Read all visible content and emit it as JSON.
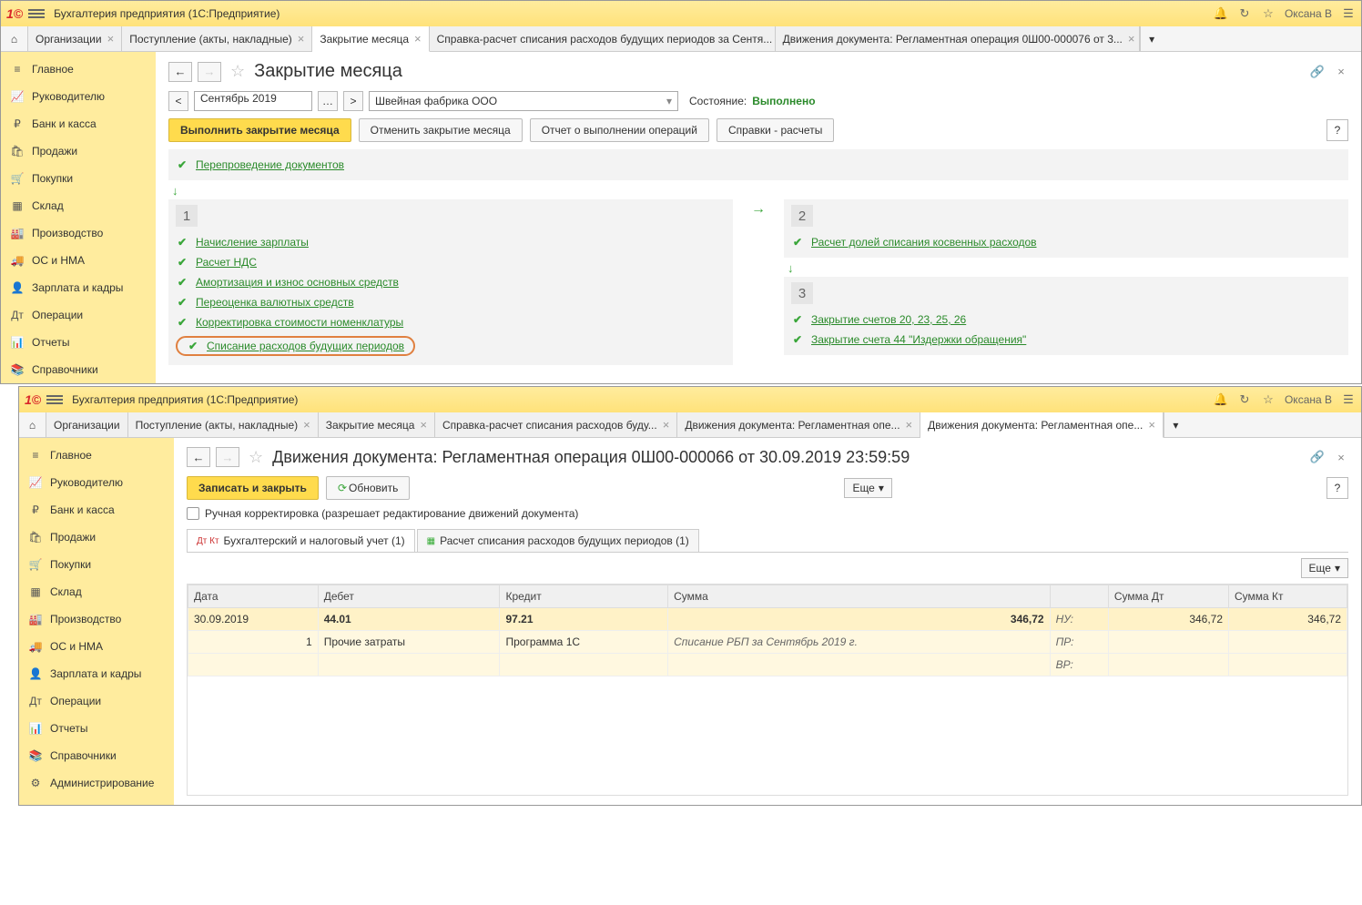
{
  "app_title": "Бухгалтерия предприятия  (1С:Предприятие)",
  "user": "Оксана В",
  "sidebar": {
    "items": [
      {
        "icon": "≡",
        "label": "Главное"
      },
      {
        "icon": "📈",
        "label": "Руководителю"
      },
      {
        "icon": "₽",
        "label": "Банк и касса"
      },
      {
        "icon": "🛍",
        "label": "Продажи"
      },
      {
        "icon": "🛒",
        "label": "Покупки"
      },
      {
        "icon": "▦",
        "label": "Склад"
      },
      {
        "icon": "🏭",
        "label": "Производство"
      },
      {
        "icon": "🚚",
        "label": "ОС и НМА"
      },
      {
        "icon": "👤",
        "label": "Зарплата и кадры"
      },
      {
        "icon": "Дт",
        "label": "Операции"
      },
      {
        "icon": "📊",
        "label": "Отчеты"
      },
      {
        "icon": "📚",
        "label": "Справочники"
      }
    ],
    "items2_extra": {
      "icon": "⚙",
      "label": "Администрирование"
    }
  },
  "win1": {
    "tabs": [
      "Организации",
      "Поступление (акты, накладные)",
      "Закрытие месяца",
      "Справка-расчет списания расходов будущих периодов за Сентя...",
      "Движения документа: Регламентная операция 0Ш00-000076 от 3..."
    ],
    "active_tab": 2,
    "page_title": "Закрытие месяца",
    "period": "Сентябрь 2019",
    "org": "Швейная фабрика ООО",
    "state_label": "Состояние:",
    "state_value": "Выполнено",
    "btns": {
      "execute": "Выполнить закрытие месяца",
      "cancel": "Отменить закрытие месяца",
      "report": "Отчет о выполнении операций",
      "refs": "Справки - расчеты"
    },
    "op_reposting": "Перепроведение документов",
    "block1": [
      "Начисление зарплаты",
      "Расчет НДС",
      "Амортизация и износ основных средств",
      "Переоценка валютных средств",
      "Корректировка стоимости номенклатуры",
      "Списание расходов будущих периодов"
    ],
    "block2": [
      "Расчет долей списания косвенных расходов"
    ],
    "block3": [
      "Закрытие счетов 20, 23, 25, 26",
      "Закрытие счета 44 \"Издержки обращения\""
    ],
    "num1": "1",
    "num2": "2",
    "num3": "3"
  },
  "win2": {
    "tabs": [
      "Организации",
      "Поступление (акты, накладные)",
      "Закрытие месяца",
      "Справка-расчет списания расходов буду...",
      "Движения документа: Регламентная опе...",
      "Движения документа: Регламентная опе..."
    ],
    "active_tab": 5,
    "page_title": "Движения документа: Регламентная операция 0Ш00-000066 от 30.09.2019 23:59:59",
    "btns": {
      "save": "Записать и закрыть",
      "refresh": "Обновить",
      "more": "Еще"
    },
    "manual_edit": "Ручная корректировка (разрешает редактирование движений документа)",
    "subtabs": [
      "Бухгалтерский и налоговый учет (1)",
      "Расчет списания расходов будущих периодов (1)"
    ],
    "table": {
      "headers": [
        "Дата",
        "Дебет",
        "Кредит",
        "Сумма",
        "",
        "Сумма Дт",
        "Сумма Кт"
      ],
      "row1": {
        "date": "30.09.2019",
        "debit": "44.01",
        "credit": "97.21",
        "sum": "346,72",
        "nu": "НУ:",
        "sum_dt": "346,72",
        "sum_kt": "346,72"
      },
      "row2": {
        "n": "1",
        "debit": "Прочие затраты",
        "credit": "Программа 1С",
        "desc": "Списание РБП за Сентябрь 2019 г.",
        "pr": "ПР:",
        "vr": "ВР:"
      }
    }
  }
}
